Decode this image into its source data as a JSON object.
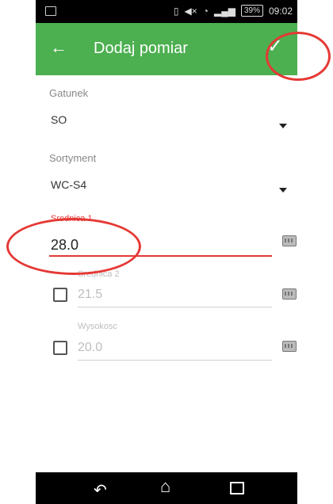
{
  "status_bar": {
    "signal_text": "",
    "battery": "39%",
    "time": "09:02"
  },
  "toolbar": {
    "back_icon": "arrow-left",
    "title": "Dodaj pomiar",
    "confirm_icon": "checkmark"
  },
  "form": {
    "gatunek": {
      "label": "Gatunek",
      "value": "SO"
    },
    "sortyment": {
      "label": "Sortyment",
      "value": "WC-S4"
    },
    "srednica1": {
      "label": "Srednica 1",
      "value": "28.0"
    },
    "srednica2": {
      "label": "Srednica 2",
      "value": "21.5"
    },
    "wysokosc": {
      "label": "Wysokosc",
      "value": "20.0"
    }
  },
  "colors": {
    "accent": "#4caf50",
    "error": "#e53935"
  }
}
